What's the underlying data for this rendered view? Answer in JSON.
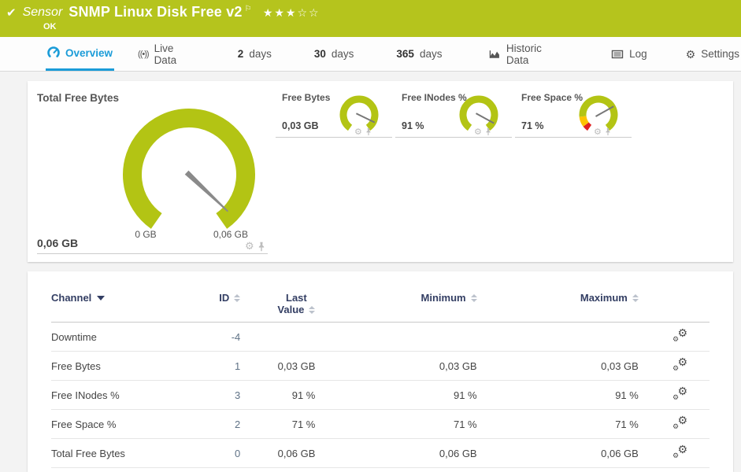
{
  "colors": {
    "brand_green": "#b5c41d",
    "accent_blue": "#1b9cd8",
    "gauge_green": "#b3c414",
    "warn_yellow": "#fdc300",
    "error_red": "#e02020",
    "table_header": "#333e63"
  },
  "icons": {
    "check": "✔",
    "flag": "⚐",
    "gear": "⚙",
    "live": "((•))"
  },
  "header": {
    "sensor_label": "Sensor",
    "title": "SNMP Linux Disk Free v2",
    "rating": "★★★☆☆",
    "status": "OK"
  },
  "tabs": {
    "overview": "Overview",
    "live_data": "Live Data",
    "d2_num": "2",
    "d2_label": "days",
    "d30_num": "30",
    "d30_label": "days",
    "d365_num": "365",
    "d365_label": "days",
    "historic": "Historic Data",
    "log": "Log",
    "settings": "Settings"
  },
  "chart_data": {
    "type": "gauge-set",
    "primary": {
      "title": "Total Free Bytes",
      "value": "0,06 GB",
      "scale_min": "0 GB",
      "scale_max": "0,06 GB",
      "needle_fraction": 0.96
    },
    "minis": [
      {
        "title": "Free Bytes",
        "value": "0,03 GB",
        "needle_fraction": 0.9
      },
      {
        "title": "Free INodes %",
        "value": "91 %",
        "needle_fraction": 0.91
      },
      {
        "title": "Free Space %",
        "value": "71 %",
        "needle_fraction": 0.71
      }
    ]
  },
  "table": {
    "headers": {
      "channel": "Channel",
      "id": "ID",
      "last_1": "Last",
      "last_2": "Value",
      "minimum": "Minimum",
      "maximum": "Maximum"
    },
    "rows": [
      {
        "channel": "Downtime",
        "id": "-4",
        "last": "",
        "min": "",
        "max": ""
      },
      {
        "channel": "Free Bytes",
        "id": "1",
        "last": "0,03 GB",
        "min": "0,03 GB",
        "max": "0,03 GB"
      },
      {
        "channel": "Free INodes %",
        "id": "3",
        "last": "91 %",
        "min": "91 %",
        "max": "91 %"
      },
      {
        "channel": "Free Space %",
        "id": "2",
        "last": "71 %",
        "min": "71 %",
        "max": "71 %"
      },
      {
        "channel": "Total Free Bytes",
        "id": "0",
        "last": "0,06 GB",
        "min": "0,06 GB",
        "max": "0,06 GB"
      }
    ]
  }
}
